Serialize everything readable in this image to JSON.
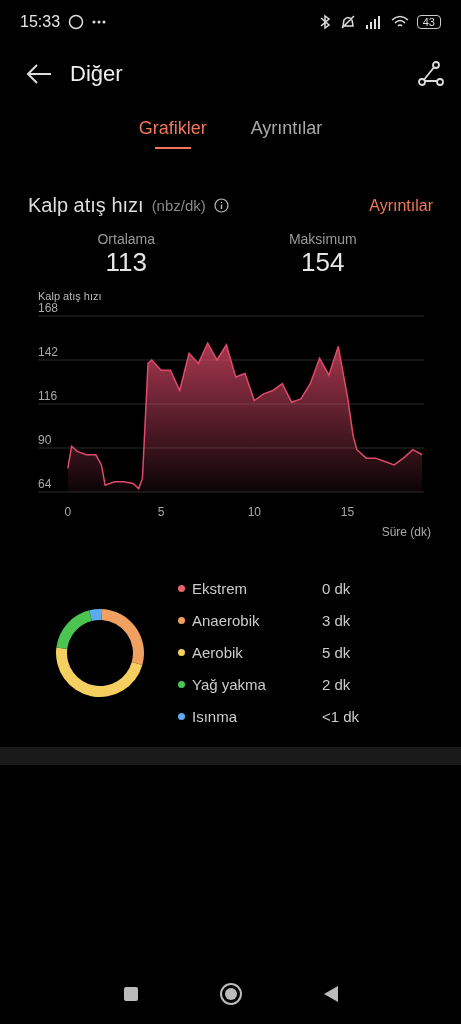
{
  "status_bar": {
    "time": "15:33",
    "battery": "43"
  },
  "header": {
    "title": "Diğer"
  },
  "tabs": [
    {
      "label": "Grafikler",
      "selected": true
    },
    {
      "label": "Ayrıntılar",
      "selected": false
    }
  ],
  "section": {
    "title": "Kalp atış hızı",
    "unit": "(nbz/dk)",
    "link": "Ayrıntılar"
  },
  "stats": [
    {
      "label": "Ortalama",
      "value": "113"
    },
    {
      "label": "Maksimum",
      "value": "154"
    }
  ],
  "heart_rate_chart": {
    "chart_data": {
      "type": "area",
      "ylabel": "Kalp atış hızı",
      "xlabel": "Süre (dk)",
      "grid": true,
      "ylim": [
        64,
        168
      ],
      "xlim": [
        -1.6,
        19.1
      ],
      "yticks": [
        64,
        90,
        116,
        142,
        168
      ],
      "xticks": [
        0,
        5,
        10,
        15
      ],
      "x": [
        0,
        0.2,
        0.5,
        1,
        1.5,
        1.8,
        2,
        2.5,
        3,
        3.5,
        3.8,
        4,
        4.3,
        4.5,
        5,
        5.5,
        6,
        6.5,
        7,
        7.5,
        8,
        8.5,
        9,
        9.5,
        10,
        10.5,
        11,
        11.5,
        12,
        12.5,
        13,
        13.5,
        14,
        14.5,
        15,
        15.3,
        15.5,
        16,
        16.5,
        17,
        17.5,
        18,
        18.5,
        19
      ],
      "series": [
        {
          "color": "#e04a6a",
          "values": [
            78,
            91,
            88,
            86,
            86,
            80,
            68,
            70,
            70,
            69,
            66,
            72,
            140,
            142,
            136,
            136,
            124,
            146,
            140,
            152,
            142,
            151,
            132,
            134,
            118,
            122,
            124,
            128,
            117,
            119,
            128,
            143,
            133,
            150,
            120,
            97,
            89,
            84,
            84,
            82,
            80,
            84,
            89,
            86
          ]
        }
      ]
    }
  },
  "zones": {
    "legend": [
      {
        "label": "Ekstrem",
        "value": "0 dk",
        "color": "#e8636b"
      },
      {
        "label": "Anaerobik",
        "value": "3 dk",
        "color": "#f0a060"
      },
      {
        "label": "Aerobik",
        "value": "5 dk",
        "color": "#f5cf5f"
      },
      {
        "label": "Yağ yakma",
        "value": "2 dk",
        "color": "#4cc451"
      },
      {
        "label": "Isınma",
        "value": "<1 dk",
        "color": "#5aabf0"
      }
    ]
  }
}
